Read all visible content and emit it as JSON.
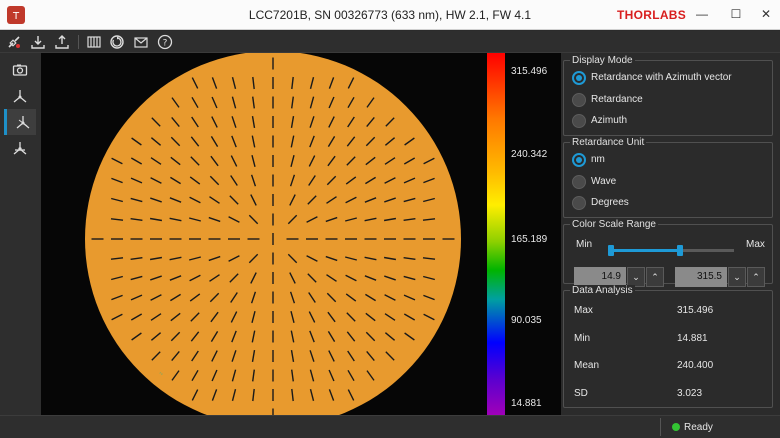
{
  "window": {
    "title": "LCC7201B, SN 00326773 (633 nm), HW 2.1, FW 4.1",
    "brand": "THORLABS",
    "controls": {
      "minimize": "—",
      "maximize": "☐",
      "close": "✕"
    }
  },
  "toolbar": {
    "icons": [
      "connect-icon",
      "download-icon",
      "upload-icon",
      "grid-icon",
      "refresh-icon",
      "mail-icon",
      "help-icon"
    ]
  },
  "sidebar": {
    "items": [
      {
        "icon": "camera-icon",
        "active": false
      },
      {
        "icon": "axes-icon",
        "active": false
      },
      {
        "icon": "polarization-icon",
        "active": true
      },
      {
        "icon": "network-icon",
        "active": false
      }
    ]
  },
  "colorbar": {
    "labels": [
      "315.496",
      "240.342",
      "165.189",
      "90.035",
      "14.881"
    ]
  },
  "display_mode": {
    "title": "Display Mode",
    "options": [
      {
        "label": "Retardance with Azimuth vector",
        "selected": true
      },
      {
        "label": "Retardance",
        "selected": false
      },
      {
        "label": "Azimuth",
        "selected": false
      }
    ]
  },
  "retardance_unit": {
    "title": "Retardance Unit",
    "options": [
      {
        "label": "nm",
        "selected": true
      },
      {
        "label": "Wave",
        "selected": false
      },
      {
        "label": "Degrees",
        "selected": false
      }
    ]
  },
  "color_scale": {
    "title": "Color Scale Range",
    "min_label": "Min",
    "max_label": "Max",
    "min_value": "14.9",
    "max_value": "315.5",
    "slider_min_fraction": 0.0,
    "slider_max_fraction": 0.57
  },
  "data_analysis": {
    "title": "Data Analysis",
    "rows": [
      {
        "key": "Max",
        "value": "315.496"
      },
      {
        "key": "Min",
        "value": "14.881"
      },
      {
        "key": "Mean",
        "value": "240.400"
      },
      {
        "key": "SD",
        "value": "3.023"
      }
    ]
  },
  "status": {
    "text": "Ready",
    "color": "#33c433"
  },
  "colors": {
    "accent": "#1e9ad6",
    "disk": "#e89a2e",
    "brand": "#d81e1e"
  }
}
